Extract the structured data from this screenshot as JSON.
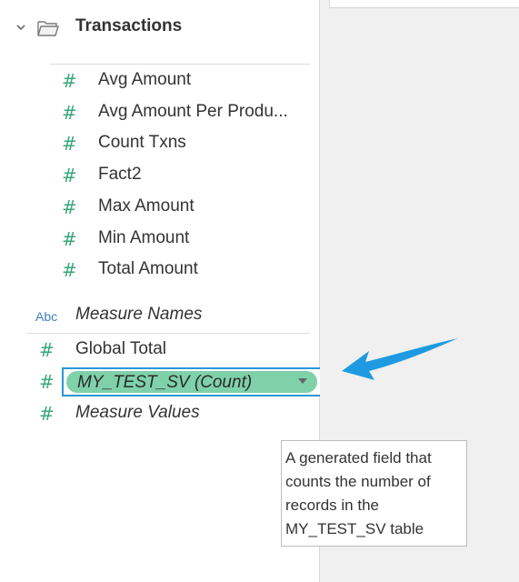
{
  "folder": {
    "title": "Transactions",
    "expand_icon": "chevron-down-icon",
    "icon": "folder-open-icon"
  },
  "measures": [
    {
      "icon": "hash",
      "label": "Avg Amount"
    },
    {
      "icon": "hash",
      "label": "Avg Amount Per Produ..."
    },
    {
      "icon": "hash",
      "label": "Count Txns"
    },
    {
      "icon": "hash",
      "label": "Fact2"
    },
    {
      "icon": "hash",
      "label": "Max Amount"
    },
    {
      "icon": "hash",
      "label": "Min Amount"
    },
    {
      "icon": "hash",
      "label": "Total Amount"
    }
  ],
  "measure_names": {
    "type_badge": "Abc",
    "label": "Measure Names"
  },
  "global_fields": [
    {
      "icon": "#",
      "label": "Global Total"
    },
    {
      "icon": "#",
      "label": "MY_TEST_SV (Count)",
      "selected": true
    },
    {
      "icon": "#",
      "label": "Measure Values"
    }
  ],
  "tooltip": {
    "lines": [
      "A generated field that",
      "counts the number of",
      "records in the",
      "MY_TEST_SV table"
    ]
  },
  "colors": {
    "measure_green": "#3ba77b",
    "selection_fill": "#7fd1aa",
    "selection_border": "#2897d9",
    "annotation_arrow": "#1e9be0",
    "abc_blue": "#3d7fc1"
  }
}
